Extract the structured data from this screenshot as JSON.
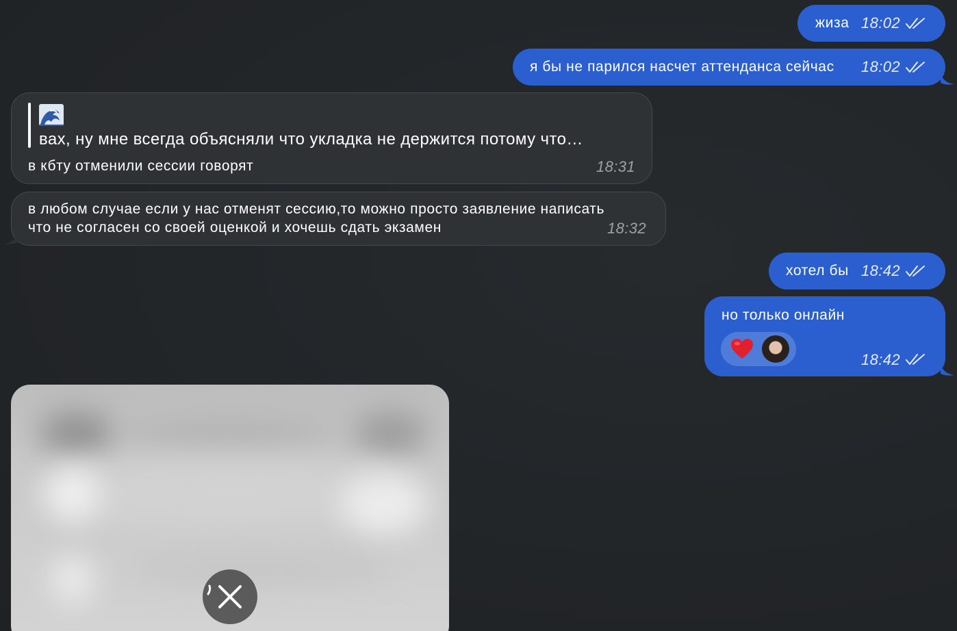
{
  "messages": [
    {
      "text": "жиза",
      "time": "18:02"
    },
    {
      "text": "я бы не парился насчет аттенданса сейчас",
      "time": "18:02"
    },
    {
      "reply_preview": "вах, ну мне всегда объясняли что укладка не держится потому что…",
      "reply_icon": "wave-emoji-icon",
      "text": "в кбту отменили сессии говорят",
      "time": "18:31"
    },
    {
      "line1": "в любом случае если у нас отменят сессию,то можно просто заявление написать",
      "line2": "что не согласен со своей оценкой и хочешь сдать экзамен",
      "time": "18:32"
    },
    {
      "text": "хотел бы",
      "time": "18:42"
    },
    {
      "text": "но только онлайн",
      "time": "18:42",
      "reaction": "heart-icon"
    }
  ],
  "media": {
    "state": "blurred",
    "action_icon": "close-icon"
  },
  "colors": {
    "background": "#222528",
    "outgoing": "#2b5fcf",
    "incoming": "#2f3235",
    "heart": "#e0202e"
  }
}
